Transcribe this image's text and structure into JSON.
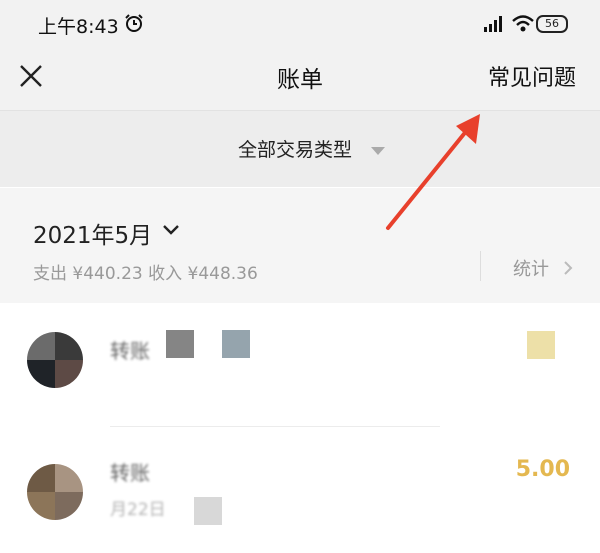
{
  "status_bar": {
    "time": "上午8:43",
    "battery": "56"
  },
  "nav": {
    "title": "账单",
    "right_link": "常见问题"
  },
  "filter": {
    "label": "全部交易类型"
  },
  "month": {
    "label": "2021年5月",
    "summary": "支出 ¥440.23 收入 ¥448.36",
    "stats_label": "统计"
  },
  "transactions": [
    {
      "title": "转账",
      "date": "",
      "amount": ""
    },
    {
      "title": "转账",
      "date": "月22日",
      "amount": "5.00"
    }
  ],
  "colors": {
    "accent": "#e4b850",
    "annotation_arrow": "#e8402c"
  }
}
